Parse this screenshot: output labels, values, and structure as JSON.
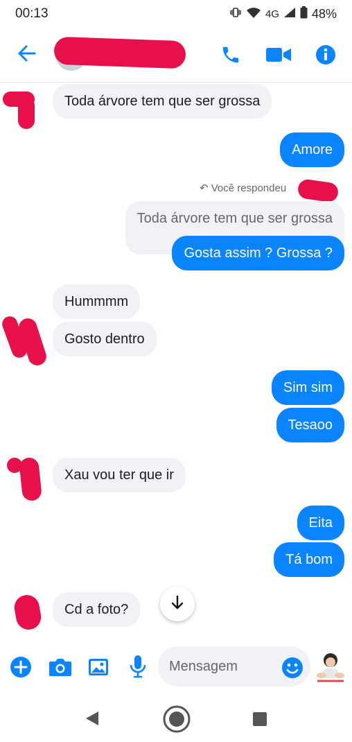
{
  "status": {
    "time": "00:13",
    "network": "4G",
    "battery": "48%"
  },
  "header": {
    "contact_name": ""
  },
  "messages": [
    {
      "text": "Toda árvore tem que ser grossa"
    },
    {
      "text": "Amore"
    },
    {
      "text": "Você respondeu"
    },
    {
      "text": "Toda árvore tem que ser grossa"
    },
    {
      "text": "Gosta assim ? Grossa ?"
    },
    {
      "text": "Hummmm"
    },
    {
      "text": "Gosto dentro"
    },
    {
      "text": "Sim sim"
    },
    {
      "text": "Tesaoo"
    },
    {
      "text": "Xau vou ter que ir"
    },
    {
      "text": "Eita"
    },
    {
      "text": "Tá bom"
    },
    {
      "text": "Cd a foto?"
    }
  ],
  "composer": {
    "placeholder": "Mensagem"
  },
  "colors": {
    "accent": "#0a84ff",
    "incoming_bubble": "#f0f2f5",
    "redaction": "#e8104a"
  }
}
